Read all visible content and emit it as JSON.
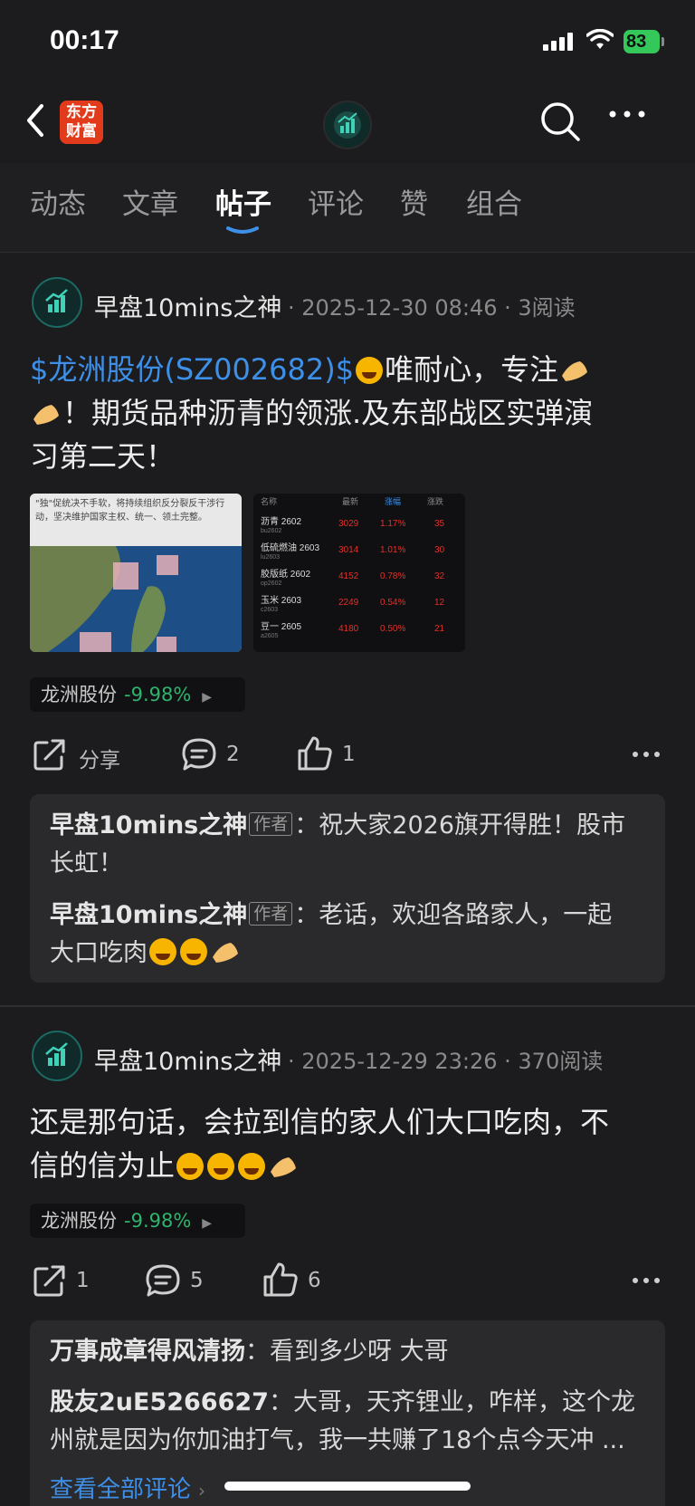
{
  "status_bar": {
    "time": "00:17",
    "battery": "83"
  },
  "header": {
    "logo_line1": "东方",
    "logo_line2": "财富"
  },
  "tabs": [
    {
      "label": "动态"
    },
    {
      "label": "文章"
    },
    {
      "label": "帖子",
      "active": true
    },
    {
      "label": "评论"
    },
    {
      "label": "赞"
    },
    {
      "label": "组合"
    }
  ],
  "posts": [
    {
      "author": "早盘10mins之神",
      "meta": "· 2025-12-30 08:46 · 3阅读",
      "text_stock": "$龙洲股份(SZ002682)$",
      "text_line1_rest": "唯耐心，专注",
      "text_line2": "！期货品种沥青的领涨.及东部战区实弹演",
      "text_line3": "习第二天！",
      "image1_caption": "\"独\"促统决不手软，将持续组织反分裂反干涉行动，坚决维护国家主权、统一、领土完整。",
      "image2_table": {
        "headers": [
          "名称",
          "最新",
          "涨幅",
          "涨跌"
        ],
        "rows": [
          {
            "name": "沥青 2602",
            "code": "bu2602",
            "price": "3029",
            "change": "1.17%",
            "extra": "35"
          },
          {
            "name": "低硫燃油 2603",
            "code": "lu2603",
            "price": "3014",
            "change": "1.01%",
            "extra": "30"
          },
          {
            "name": "胶版纸 2602",
            "code": "op2602",
            "price": "4152",
            "change": "0.78%",
            "extra": "32"
          },
          {
            "name": "玉米 2603",
            "code": "c2603",
            "price": "2249",
            "change": "0.54%",
            "extra": "12"
          },
          {
            "name": "豆一 2605",
            "code": "a2605",
            "price": "4180",
            "change": "0.50%",
            "extra": "21"
          }
        ]
      },
      "chip": {
        "name": "龙洲股份",
        "pct": "-9.98%"
      },
      "actions": {
        "share": "分享",
        "comments": "2",
        "likes": "1"
      },
      "comments": [
        {
          "name": "早盘10mins之神",
          "tag": "作者",
          "text_a": "：祝大家2026旗开得胜！股市",
          "text_b": "长虹！"
        },
        {
          "name": "早盘10mins之神",
          "tag": "作者",
          "text_a": "：老话，欢迎各路家人，一起",
          "text_b": "大口吃肉"
        }
      ]
    },
    {
      "author": "早盘10mins之神",
      "meta": "· 2025-12-29 23:26 · 370阅读",
      "text_line1": "还是那句话，会拉到信的家人们大口吃肉，不",
      "text_line2": "信的信为止",
      "chip": {
        "name": "龙洲股份",
        "pct": "-9.98%"
      },
      "actions": {
        "shares": "1",
        "comments": "5",
        "likes": "6"
      },
      "comments": [
        {
          "name": "万事成章得风清扬",
          "text": "：看到多少呀 大哥"
        },
        {
          "name": "股友2uE5266627",
          "text_a": "：大哥，天齐锂业，咋样，这个龙",
          "text_b": "州就是因为你加油打气，我一共赚了18个点今天冲 ..."
        }
      ],
      "view_all": "查看全部评论"
    }
  ],
  "colors": {
    "accent_blue": "#3d8fe8",
    "down_green": "#2fb36d",
    "up_red": "#e0312b",
    "logo_red": "#e23b1c"
  }
}
